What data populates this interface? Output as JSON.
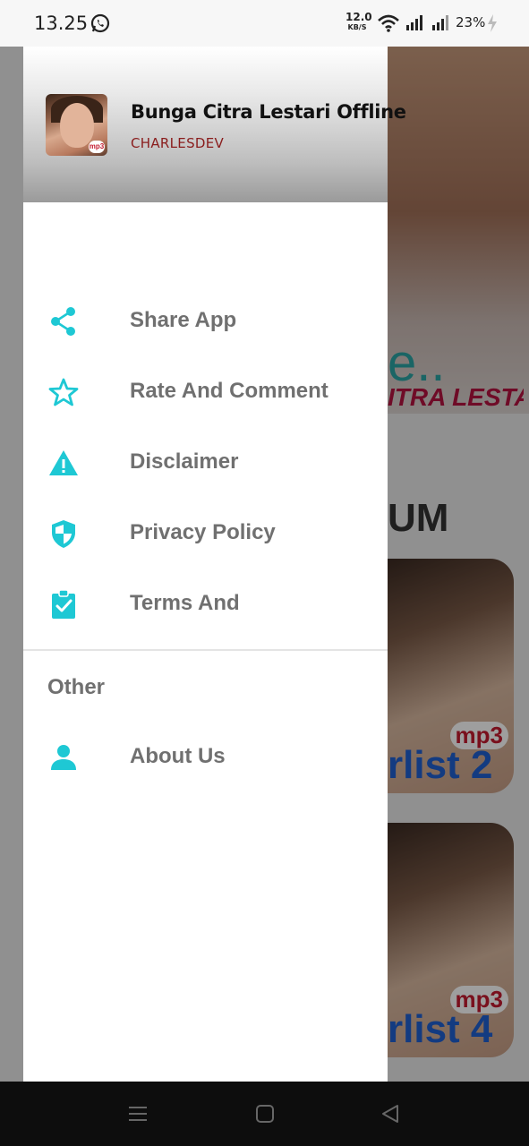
{
  "status_bar": {
    "time": "13.25",
    "net_speed_value": "12.0",
    "net_speed_unit": "KB/S",
    "battery": "23%"
  },
  "drawer": {
    "header": {
      "app_title": "Bunga Citra Lestari Offline",
      "developer": "CHARLESDEV",
      "avatar_badge": "mp3"
    },
    "items": [
      {
        "label": "Share App",
        "icon": "share-icon"
      },
      {
        "label": "Rate And Comment",
        "icon": "star-icon"
      },
      {
        "label": "Disclaimer",
        "icon": "warning-icon"
      },
      {
        "label": "Privacy Policy",
        "icon": "shield-icon"
      },
      {
        "label": "Terms And",
        "icon": "clipboard-check-icon"
      }
    ],
    "section_label": "Other",
    "other_items": [
      {
        "label": "About Us",
        "icon": "person-icon"
      }
    ]
  },
  "background": {
    "banner_text": "e..",
    "banner_strip": "ITRA LESTARI",
    "section_title": "UM",
    "cards": [
      {
        "label": "rlist 2",
        "badge": "mp3"
      },
      {
        "label": "rlist 4",
        "badge": "mp3"
      }
    ]
  },
  "colors": {
    "accent": "#1ec8d4",
    "label_gray": "#707070",
    "developer_text": "#8a1d1d",
    "nav_bar": "#0d0d0d"
  }
}
